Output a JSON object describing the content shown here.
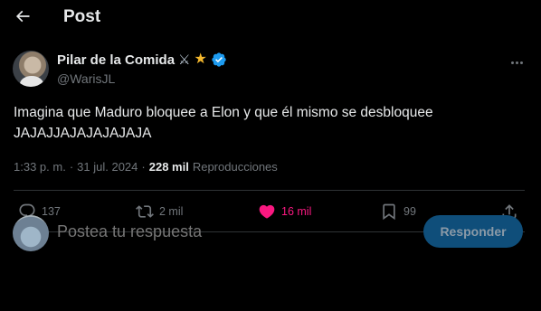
{
  "header": {
    "title": "Post"
  },
  "tweet": {
    "display_name": "Pilar de la Comida",
    "name_emojis": [
      "crossed-swords",
      "star"
    ],
    "handle": "@WarisJL",
    "text_line1": "Imagina que Maduro bloquee a Elon y que él mismo se desbloquee",
    "text_line2": "JAJAJJAJAJAJAJAJA",
    "time": "1:33 p. m.",
    "separator": "·",
    "date": "31 jul. 2024",
    "views_count": "228 mil",
    "views_label": "Reproducciones"
  },
  "actions": {
    "replies": "137",
    "reposts": "2 mil",
    "likes": "16 mil",
    "bookmarks": "99"
  },
  "reply": {
    "placeholder": "Postea tu respuesta",
    "button_label": "Responder"
  },
  "colors": {
    "background": "#000000",
    "text": "#e7e9ea",
    "muted": "#71767b",
    "like": "#f91880",
    "verified": "#1d9bf0",
    "button_disabled": "#0f4e7a"
  }
}
